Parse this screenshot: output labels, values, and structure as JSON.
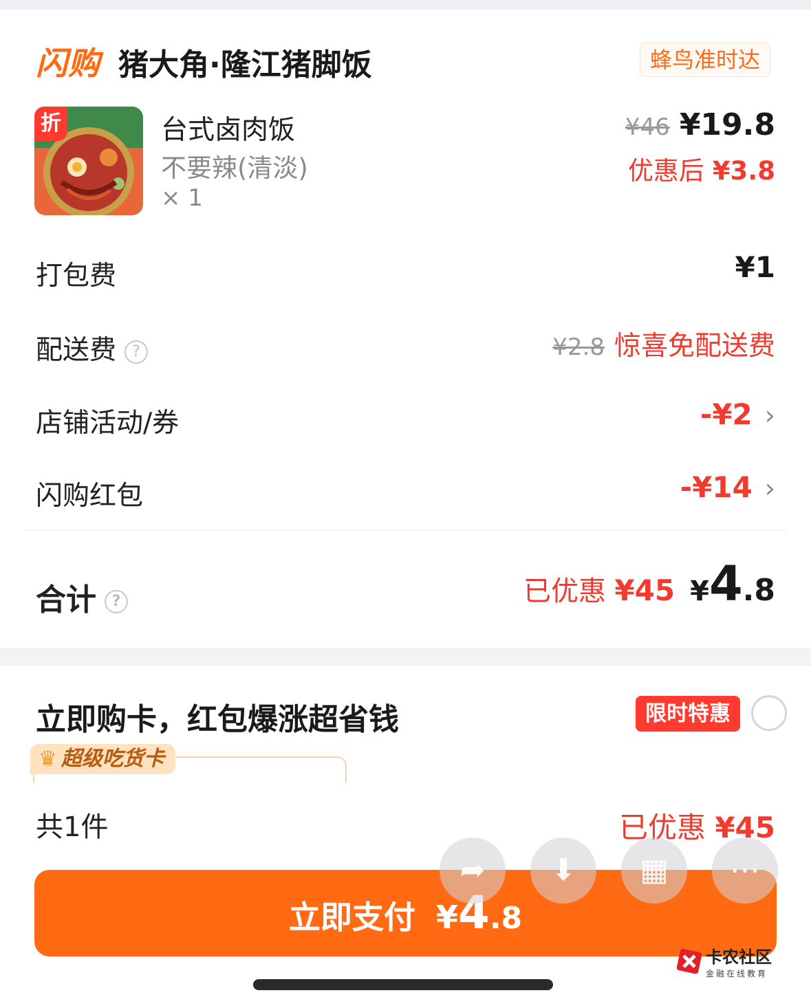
{
  "header": {
    "brand": "闪购",
    "shop_name": "猪大角·隆江猪脚饭",
    "delivery_badge": "蜂鸟准时达"
  },
  "item": {
    "discount_tag": "折",
    "name": "台式卤肉饭",
    "spec": "不要辣(清淡)",
    "qty": "× 1",
    "original_price": "¥46",
    "price": "¥19.8",
    "after_discount_label": "优惠后",
    "after_discount_price": "¥3.8"
  },
  "rows": {
    "packaging": {
      "label": "打包费",
      "value": "¥1"
    },
    "delivery": {
      "label": "配送费",
      "original": "¥2.8",
      "value": "惊喜免配送费"
    },
    "store_promo": {
      "label": "店铺活动/券",
      "value": "-¥2"
    },
    "red_packet": {
      "label": "闪购红包",
      "value": "-¥14"
    }
  },
  "total": {
    "label": "合计",
    "saved_label": "已优惠",
    "saved_amount": "¥45",
    "currency": "¥",
    "amount_int": "4",
    "amount_dec": ".8"
  },
  "promo": {
    "title": "立即购卡，红包爆涨超省钱",
    "limited_badge": "限时特惠",
    "card_tag": "超级吃货卡"
  },
  "footer": {
    "count": "共1件",
    "saved_label": "已优惠",
    "saved_amount": "¥45",
    "pay_label": "立即支付",
    "pay_currency": "¥",
    "pay_int": "4",
    "pay_dec": ".8"
  },
  "watermark": {
    "title": "卡农社区",
    "subtitle": "金融在线教育"
  },
  "colors": {
    "accent": "#ff6a13",
    "red": "#f03b2f"
  }
}
